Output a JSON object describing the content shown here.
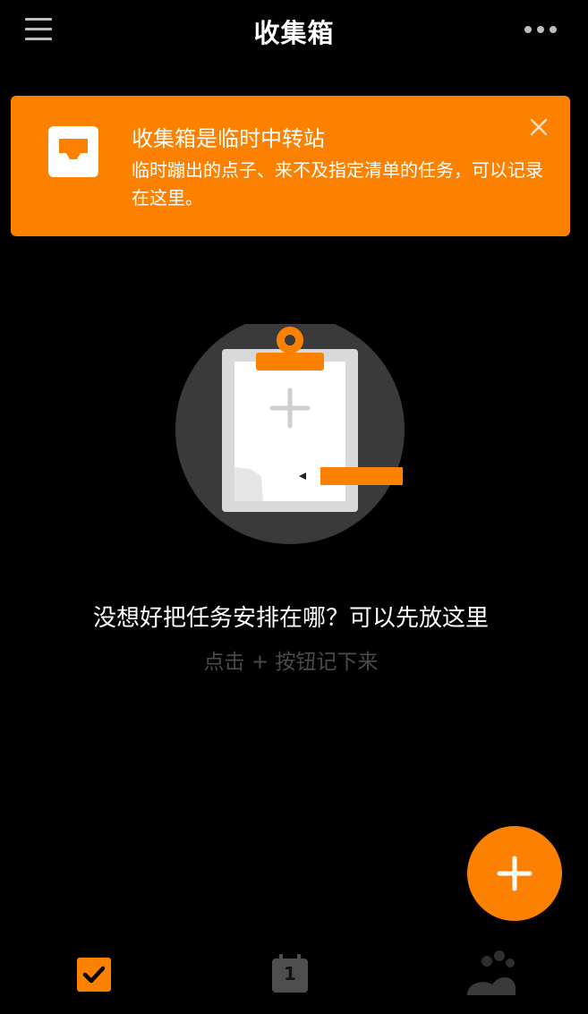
{
  "header": {
    "title": "收集箱",
    "menu_icon": "hamburger-menu-icon",
    "more_icon": "more-dots-icon"
  },
  "banner": {
    "title": "收集箱是临时中转站",
    "description": "临时蹦出的点子、来不及指定清单的任务，可以记录在这里。",
    "icon": "inbox-tray-icon",
    "close_icon": "close-icon",
    "background_color": "#fd8100"
  },
  "empty_state": {
    "illustration": "clipboard-with-pencil-illustration",
    "title": "没想好把任务安排在哪？可以先放这里",
    "hint": "点击 + 按钮记下来"
  },
  "fab": {
    "icon": "plus-icon",
    "color": "#fd8100"
  },
  "bottom_tabs": {
    "tasks_icon": "checkbox-icon",
    "calendar_icon": "calendar-icon",
    "calendar_day": "1",
    "profile_icon": "paw-icon"
  },
  "colors": {
    "accent": "#fd8100",
    "background": "#000000",
    "hint_text": "#4a4a4a"
  }
}
